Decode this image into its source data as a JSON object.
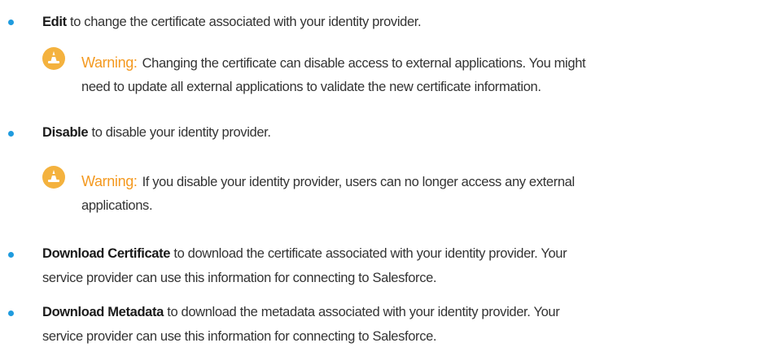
{
  "items": [
    {
      "bold": "Edit",
      "rest": " to change the certificate associated with your identity provider.",
      "warning": {
        "title": "Warning:",
        "line1": "Changing the certificate can disable access to external applications. You might",
        "line2": "need to update all external applications to validate the new certificate information."
      }
    },
    {
      "bold": "Disable",
      "rest": " to disable your identity provider.",
      "warning": {
        "title": "Warning:",
        "line1": "If you disable your identity provider, users can no longer access any external",
        "line2": "applications."
      }
    },
    {
      "bold": "Download Certificate",
      "rest": " to download the certificate associated with your identity provider. Your",
      "line2": "service provider can use this information for connecting to Salesforce."
    },
    {
      "bold": "Download Metadata",
      "rest": " to download the metadata associated with your identity provider. Your",
      "line2": "service provider can use this information for connecting to Salesforce."
    }
  ],
  "colors": {
    "bullet": "#1f9bde",
    "warning_title": "#f4991f",
    "warning_icon": "#f4b23e",
    "text": "#333333"
  },
  "icons": {
    "warning": "warning-cone-icon"
  }
}
